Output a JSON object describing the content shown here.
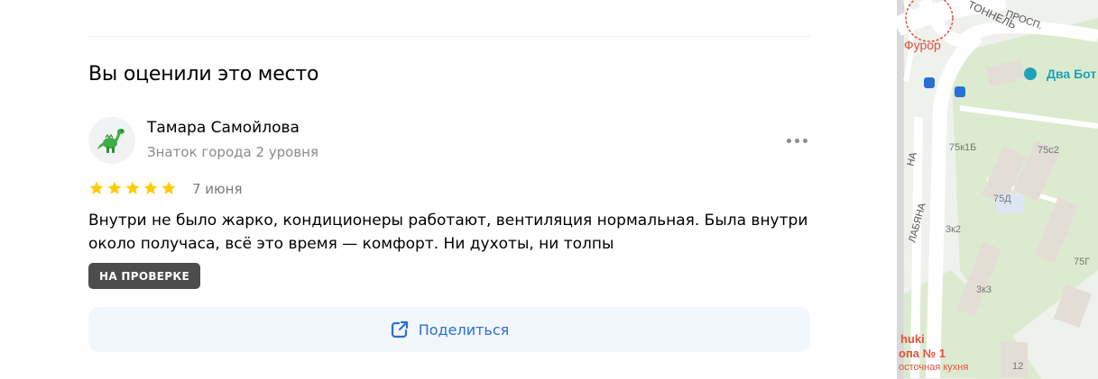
{
  "review_section": {
    "title": "Вы оценили это место"
  },
  "review": {
    "author": {
      "name": "Тамара Самойлова",
      "level": "Знаток города 2 уровня",
      "avatar_icon": "dinosaur-icon"
    },
    "rating": 5,
    "rating_max": 5,
    "date": "7 июня",
    "text": "Внутри не было жарко, кондиционеры работают, вентиляция нормальная. Была внутри около получаса, всё это время — комфорт. Ни духоты, ни толпы",
    "status_badge": "НА ПРОВЕРКЕ",
    "star_color": "#ffcc00"
  },
  "actions": {
    "share_label": "Поделиться",
    "share_icon": "share-external-icon",
    "more_icon": "more-dots-icon"
  },
  "map": {
    "labels": {
      "street_top": "ПРОСП.",
      "tunnel": "ТОННЕЛЬ",
      "place_furor": "Фурор",
      "place_dva": "Два Бот",
      "street_left_1": "НА",
      "street_left_2": "ЛАБЯНА",
      "bldg_1": "75к1Б",
      "bldg_2": "75с2",
      "bldg_3": "75Д",
      "bldg_4": "3к2",
      "bldg_5": "75Г",
      "bldg_6": "3к3",
      "bldg_7": "12",
      "place_bottom_1": "huki",
      "place_bottom_2": "опа № 1",
      "place_bottom_3": "осточная кухня"
    },
    "colors": {
      "park": "#dcebcf",
      "road": "#ffffff",
      "building": "#e3ddd6",
      "accent_red": "#e0523f",
      "accent_teal": "#1ea2b8",
      "transport_blue": "#2b6fd6"
    }
  }
}
